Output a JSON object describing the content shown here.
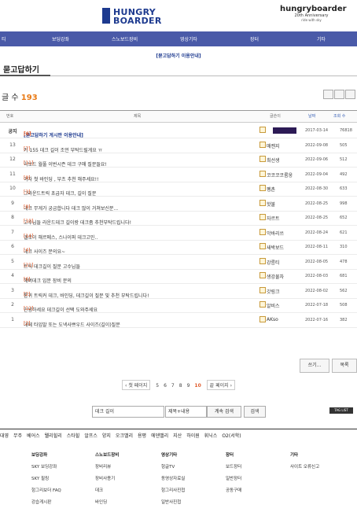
{
  "header": {
    "logo_line1": "HUNGRY",
    "logo_line2": "BOARDER",
    "anniv_title": "hungryboarder",
    "anniv_sub": "20th Anniversary",
    "anniv_tag": "ride with sky"
  },
  "nav": {
    "items": [
      "티",
      "보딩강좌",
      "스노보드장비",
      "영상기타",
      "장터",
      "기타"
    ]
  },
  "subnav": "[묻고답하기 이용안내]",
  "board": {
    "title": "묻고답하기",
    "count_label": "글 수",
    "count": "193",
    "sort_date": "날짜",
    "sort_views": "조회 수",
    "headers": {
      "num": "번호",
      "title": "제목",
      "author": "글쓴이"
    }
  },
  "rows": [
    {
      "num": "공지",
      "title": "[묻고답하기 게시판 이용안내]",
      "cc": "[6]",
      "author": "",
      "date": "2017-03-14",
      "views": "76818",
      "notice": true
    },
    {
      "num": "13",
      "title": "키 155 데크 길이 조언 부탁드릴게요 ㅠ",
      "cc": "[7]",
      "author": "매켄지",
      "date": "2022-09-08",
      "views": "505"
    },
    {
      "num": "12",
      "title": "약보드 월풀 이번시즌 데크 구매 질문들요!",
      "cc": "[11]",
      "author": "최선생",
      "date": "2022-09-06",
      "views": "512"
    },
    {
      "num": "11",
      "title": "여자 첫 바인딩 , 부츠 추천 해주세요!!",
      "cc": "[8]",
      "author": "코코코코룸웅",
      "date": "2022-09-04",
      "views": "492"
    },
    {
      "num": "10",
      "title": "그라운드트릭 초급자 데크, 길이 질문",
      "cc": "[3]",
      "author": "펭촌",
      "date": "2022-08-30",
      "views": "633"
    },
    {
      "num": "9",
      "title": "데크 무게가 궁금합니다 데크 많이 거쳐보신분...",
      "cc": "[8]",
      "author": "핫불",
      "date": "2022-08-25",
      "views": "998"
    },
    {
      "num": "8",
      "title": "고수님들 라운드데크 길이랑 데크좀 추천부탁드립니다!",
      "cc": "[10]",
      "author": "자르트",
      "date": "2022-08-25",
      "views": "652"
    },
    {
      "num": "7",
      "title": "엘로이 해르메스, 스나이퍼 데크고민..",
      "cc": "[14]",
      "author": "악바리쓰",
      "date": "2022-08-24",
      "views": "621"
    },
    {
      "num": "6",
      "title": "데크 사이즈 문의요~",
      "cc": "[4]",
      "author": "새박보드",
      "date": "2022-08-11",
      "views": "310"
    },
    {
      "num": "5",
      "title": "트릭 데크길이 질문 고수님들",
      "cc": "[21]",
      "author": "강릉티",
      "date": "2022-08-05",
      "views": "478"
    },
    {
      "num": "4",
      "title": "헤머데크 입문 장비 문의",
      "cc": "[6]",
      "author": "생강물차",
      "date": "2022-08-03",
      "views": "681"
    },
    {
      "num": "3",
      "title": "통귀 트릭커 데크, 바인딩, 데크길이 질문 및 추천 부탁드립니다!",
      "cc": "[2]",
      "author": "갓링크",
      "date": "2022-08-02",
      "views": "562"
    },
    {
      "num": "2",
      "title": "안녕하세요 데크길이 선택 도와주세요",
      "cc": "[12]",
      "author": "알비스",
      "date": "2022-07-18",
      "views": "508"
    },
    {
      "num": "1",
      "title": "데페 타입말 또는 도넥사쁘우드 사이즈(길이)질문",
      "cc": "[2]",
      "author": "AKso",
      "date": "2022-07-16",
      "views": "382"
    }
  ],
  "actions": {
    "write": "쓰기...",
    "list": "목록"
  },
  "pager": {
    "prev": "‹ 첫 페이지",
    "pages": [
      "5",
      "6",
      "7",
      "8",
      "9",
      "10"
    ],
    "current": "10",
    "next": "끝 페이지 ›"
  },
  "search": {
    "value": "데크 길이",
    "select": "제목+내용",
    "button": "계속 검색",
    "button2": "검색",
    "tags": "TAG LIST"
  },
  "brands": [
    "대영",
    "무주",
    "베어스",
    "웰리힐리",
    "스타힐",
    "알프스",
    "양지",
    "오크밸리",
    "용평",
    "에덴밸리",
    "지산",
    "하이원",
    "휘닉스",
    "O2(서학)"
  ],
  "footer": {
    "cols": [
      {
        "head": "보딩강좌",
        "items": [
          "SKY 보딩강좌",
          "SKY 필링",
          "헝그리보더 FAQ",
          "강습게시판"
        ]
      },
      {
        "head": "스노보드장비",
        "items": [
          "장비리뷰",
          "장비사용기",
          "데크",
          "바인딩"
        ]
      },
      {
        "head": "영상기타",
        "items": [
          "헝글TV",
          "동영상자료실",
          "헝그리사진첩",
          "일반사진첩"
        ]
      },
      {
        "head": "장터",
        "items": [
          "보드장터",
          "일반장터",
          "공동구매"
        ]
      },
      {
        "head": "기타",
        "items": [
          "사이트 오류신고"
        ]
      }
    ]
  }
}
